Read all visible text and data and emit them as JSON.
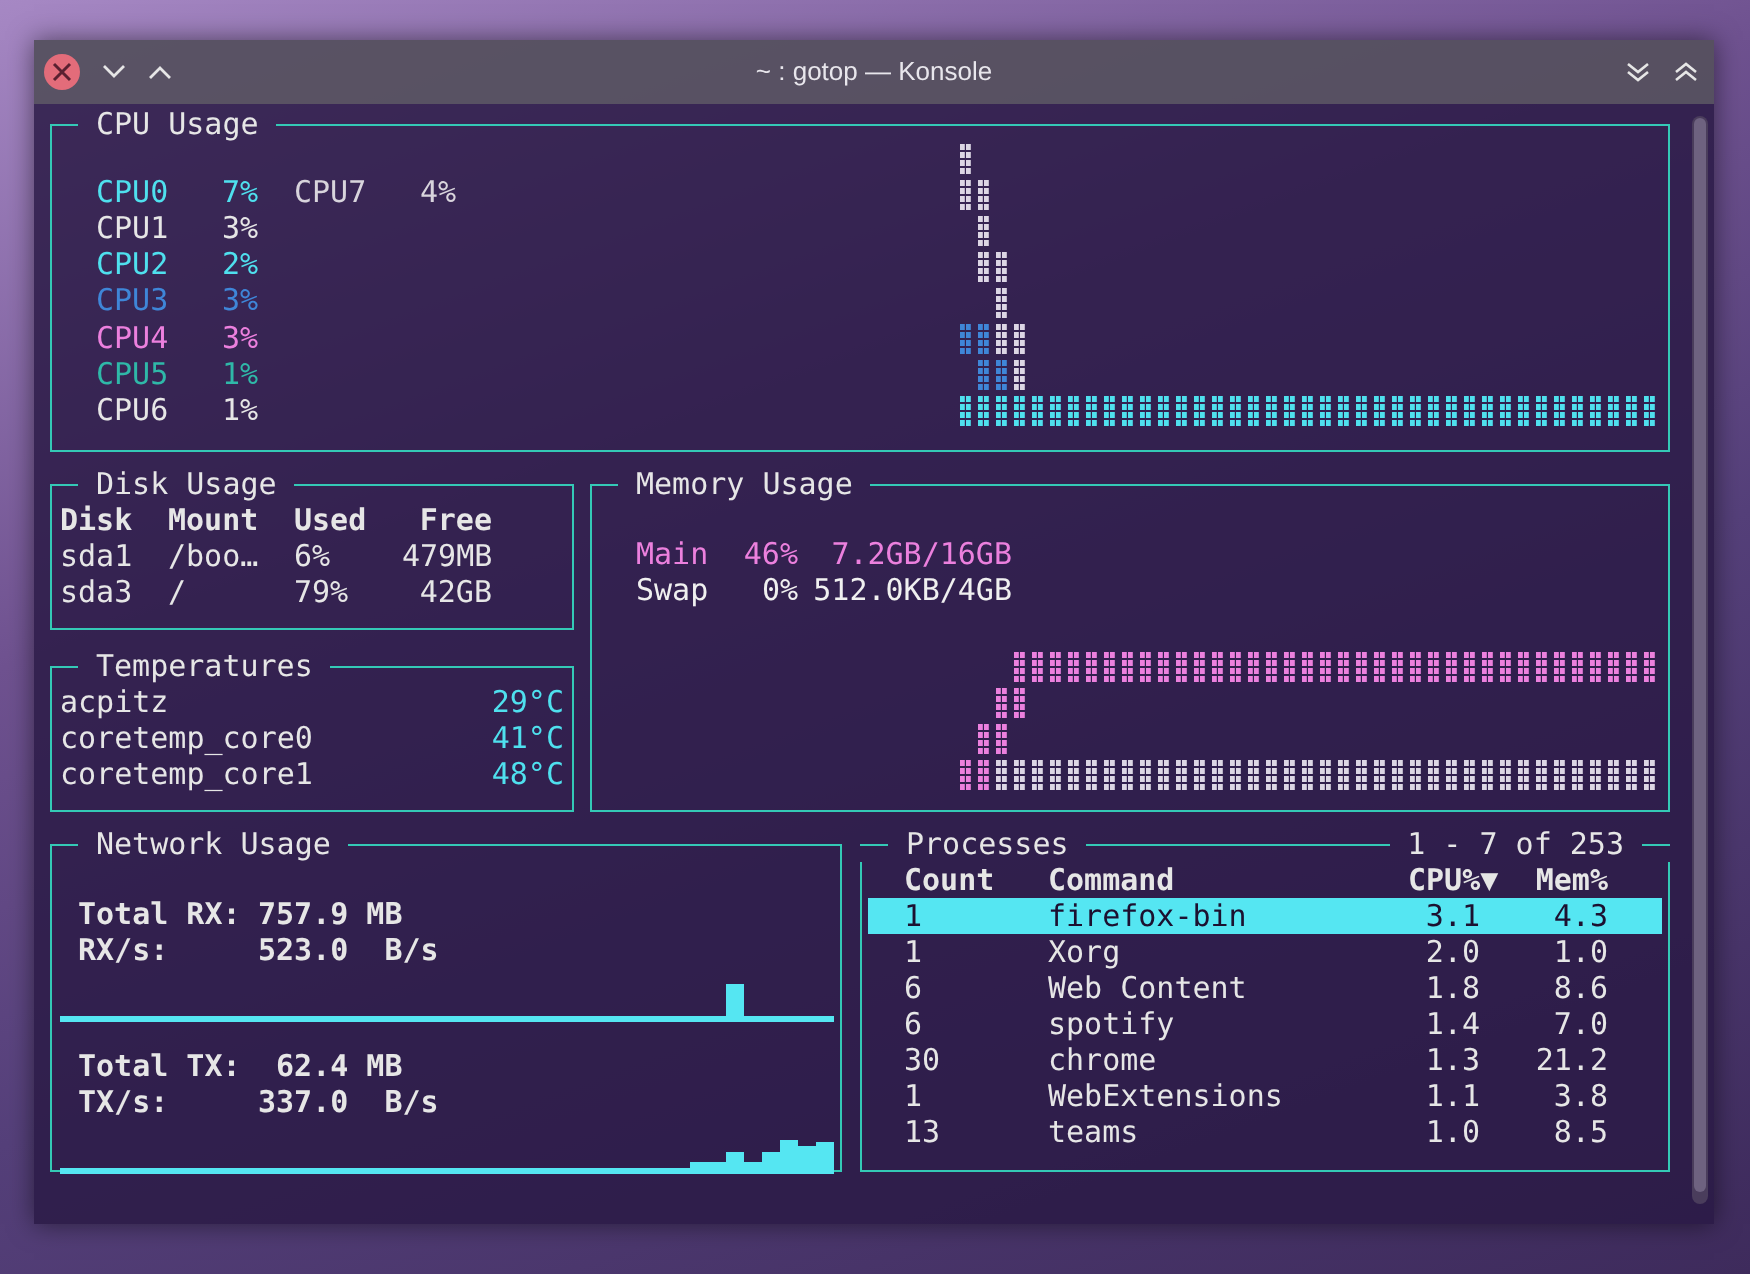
{
  "window": {
    "title": "~ : gotop — Konsole"
  },
  "cpu": {
    "title": "CPU Usage",
    "cores": [
      {
        "name": "CPU0",
        "percent": "7%",
        "color": "#4fe0ee"
      },
      {
        "name": "CPU1",
        "percent": "3%",
        "color": "#e6e6e6"
      },
      {
        "name": "CPU2",
        "percent": "2%",
        "color": "#4fe0ee"
      },
      {
        "name": "CPU3",
        "percent": "3%",
        "color": "#3f86d8"
      },
      {
        "name": "CPU4",
        "percent": "3%",
        "color": "#ec80de"
      },
      {
        "name": "CPU5",
        "percent": "1%",
        "color": "#2fb8a8"
      },
      {
        "name": "CPU6",
        "percent": "1%",
        "color": "#e6e6e6"
      },
      {
        "name": "CPU7",
        "percent": "4%",
        "color": "#d8d4dc"
      }
    ]
  },
  "disk": {
    "title": "Disk Usage",
    "columns": [
      "Disk",
      "Mount",
      "Used",
      "Free"
    ],
    "rows": [
      [
        "sda1",
        "/boo…",
        "6%",
        "479MB"
      ],
      [
        "sda3",
        "/",
        "79%",
        "42GB"
      ]
    ]
  },
  "temperatures": {
    "title": "Temperatures",
    "rows": [
      {
        "name": "acpitz",
        "value": "29°C"
      },
      {
        "name": "coretemp_core0",
        "value": "41°C"
      },
      {
        "name": "coretemp_core1",
        "value": "48°C"
      }
    ]
  },
  "memory": {
    "title": "Memory Usage",
    "rows": [
      {
        "name": "Main",
        "percent": "46%",
        "amount": "7.2GB/16GB",
        "color": "#ec80de"
      },
      {
        "name": "Swap",
        "percent": "0%",
        "amount": "512.0KB/4GB",
        "color": "#f0f0f0"
      }
    ]
  },
  "network": {
    "title": "Network Usage",
    "blocks": [
      {
        "total_label": "Total RX:",
        "total": "757.9 MB",
        "rate_label": "RX/s:",
        "rate": "523.0  B/s"
      },
      {
        "total_label": "Total TX:",
        "total": " 62.4 MB",
        "rate_label": "TX/s:",
        "rate": "337.0  B/s"
      }
    ]
  },
  "processes": {
    "title": "Processes",
    "range": "1 - 7 of 253",
    "columns": [
      "Count",
      "Command",
      "CPU%▼",
      "Mem%"
    ],
    "rows": [
      {
        "count": "1",
        "command": "firefox-bin",
        "cpu": "3.1",
        "mem": "4.3",
        "selected": true
      },
      {
        "count": "1",
        "command": "Xorg",
        "cpu": "2.0",
        "mem": "1.0",
        "selected": false
      },
      {
        "count": "6",
        "command": "Web Content",
        "cpu": "1.8",
        "mem": "8.6",
        "selected": false
      },
      {
        "count": "6",
        "command": "spotify",
        "cpu": "1.4",
        "mem": "7.0",
        "selected": false
      },
      {
        "count": "30",
        "command": "chrome",
        "cpu": "1.3",
        "mem": "21.2",
        "selected": false
      },
      {
        "count": "1",
        "command": "WebExtensions",
        "cpu": "1.1",
        "mem": "3.8",
        "selected": false
      },
      {
        "count": "13",
        "command": "teams",
        "cpu": "1.0",
        "mem": "8.5",
        "selected": false
      }
    ]
  }
}
